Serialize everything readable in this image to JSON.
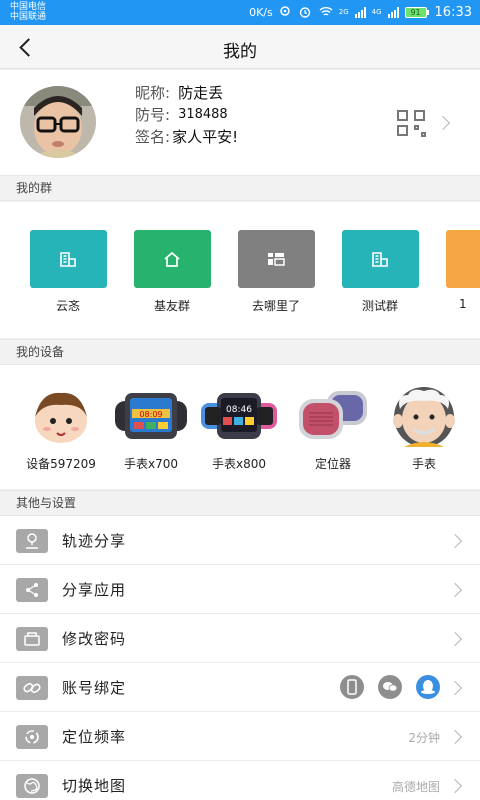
{
  "status_bar": {
    "carrier1": "中国电信",
    "carrier2": "中国联通",
    "speed": "0K/s",
    "net1": "2G",
    "net2": "4G",
    "battery": "91",
    "time": "16:33"
  },
  "nav": {
    "title": "我的"
  },
  "profile": {
    "nickname_label": "昵称:",
    "nickname": "防走丢",
    "id_label": "防号:",
    "id": "318488",
    "signature_label": "签名:",
    "signature": "家人平安!"
  },
  "groups": {
    "header": "我的群",
    "items": [
      {
        "name": "云忞",
        "color": "#26b4b8"
      },
      {
        "name": "基友群",
        "color": "#27b36d"
      },
      {
        "name": "去哪里了",
        "color": "#808080"
      },
      {
        "name": "测试群",
        "color": "#26b4b8"
      },
      {
        "name": "1",
        "color": "#f4a742"
      }
    ]
  },
  "devices": {
    "header": "我的设备",
    "items": [
      {
        "name": "设备597209"
      },
      {
        "name": "手表x700"
      },
      {
        "name": "手表x800"
      },
      {
        "name": "定位器"
      },
      {
        "name": "手表"
      }
    ]
  },
  "settings": {
    "header": "其他与设置",
    "items": [
      {
        "label": "轨迹分享",
        "value": ""
      },
      {
        "label": "分享应用",
        "value": ""
      },
      {
        "label": "修改密码",
        "value": ""
      },
      {
        "label": "账号绑定",
        "value": ""
      },
      {
        "label": "定位频率",
        "value": "2分钟"
      },
      {
        "label": "切换地图",
        "value": "高德地图"
      }
    ]
  }
}
